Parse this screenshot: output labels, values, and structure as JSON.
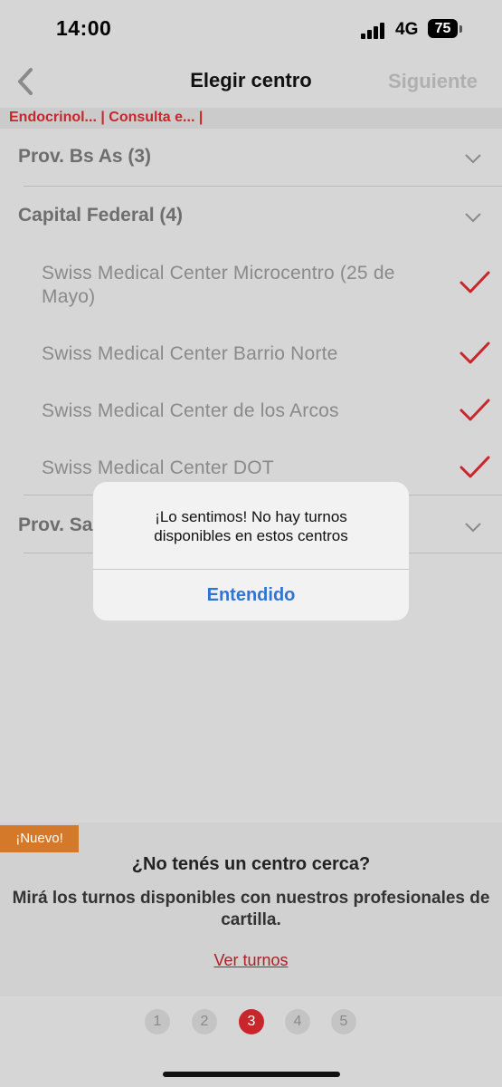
{
  "status_bar": {
    "time": "14:00",
    "network": "4G",
    "battery": "75"
  },
  "nav": {
    "title": "Elegir centro",
    "next_label": "Siguiente"
  },
  "breadcrumb": "Endocrinol... | Consulta e... |",
  "groups": [
    {
      "label": "Prov. Bs As (3)"
    },
    {
      "label": "Capital Federal (4)"
    },
    {
      "label": "Prov. Sa"
    }
  ],
  "centers": [
    {
      "name": "Swiss Medical Center Microcentro (25 de Mayo)",
      "selected": true
    },
    {
      "name": "Swiss Medical Center Barrio Norte",
      "selected": true
    },
    {
      "name": "Swiss Medical Center de los Arcos",
      "selected": true
    },
    {
      "name": "Swiss Medical Center DOT",
      "selected": true
    }
  ],
  "dialog": {
    "message": "¡Lo sentimos! No hay turnos disponibles en estos centros",
    "button": "Entendido"
  },
  "promo": {
    "badge": "¡Nuevo!",
    "title": "¿No tenés un centro cerca?",
    "text": "Mirá los turnos disponibles con nuestros profesionales de cartilla.",
    "link": "Ver turnos"
  },
  "pagination": {
    "pages": [
      "1",
      "2",
      "3",
      "4",
      "5"
    ],
    "current": "3"
  },
  "colors": {
    "accent_red": "#c8262a",
    "link_blue": "#2f75d6",
    "badge_orange": "#d4792a"
  }
}
